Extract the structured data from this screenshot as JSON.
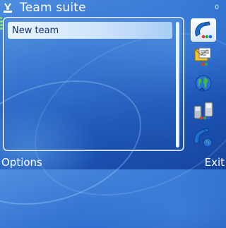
{
  "header": {
    "title": "Team suite",
    "app_icon": "team-suite-icon",
    "battery_indicator": "0"
  },
  "list": {
    "items": [
      {
        "label": "New team",
        "selected": true
      }
    ]
  },
  "toolbar": {
    "items": [
      {
        "name": "call-team-icon",
        "active": true
      },
      {
        "name": "message-team-icon",
        "active": false
      },
      {
        "name": "web-icon",
        "active": false
      },
      {
        "name": "contacts-icon",
        "active": false
      },
      {
        "name": "conference-call-icon",
        "active": false
      }
    ]
  },
  "softkeys": {
    "left": "Options",
    "right": "Exit"
  },
  "colors": {
    "background": "#2f6fcf",
    "selection": "#cfe4fb",
    "text_on_selection": "#10306a",
    "softkey_text": "#ffffff"
  }
}
